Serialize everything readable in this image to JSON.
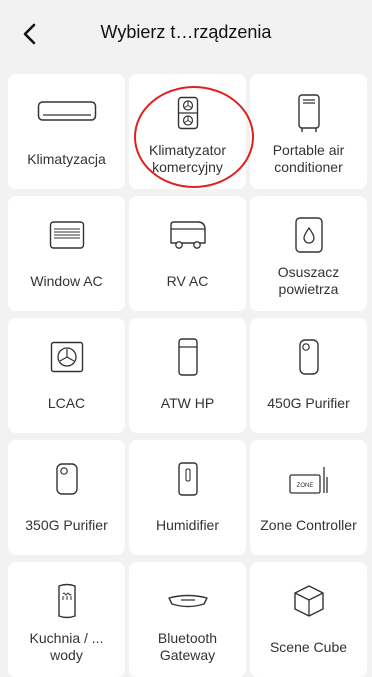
{
  "header": {
    "title": "Wybierz t…rządzenia",
    "back_icon": "chevron-left-icon"
  },
  "devices": [
    {
      "id": "klimatyzacja",
      "label": "Klimatyzacja",
      "icon": "wall-ac-icon"
    },
    {
      "id": "klimatyzator-komercyjny",
      "label": "Klimatyzator komercyjny",
      "icon": "commercial-ac-icon",
      "highlighted": true
    },
    {
      "id": "portable-air-conditioner",
      "label": "Portable air conditioner",
      "icon": "portable-ac-icon"
    },
    {
      "id": "window-ac",
      "label": "Window AC",
      "icon": "window-ac-icon"
    },
    {
      "id": "rv-ac",
      "label": "RV AC",
      "icon": "rv-icon"
    },
    {
      "id": "osuszacz-powietrza",
      "label": "Osuszacz powietrza",
      "icon": "dehumidifier-icon"
    },
    {
      "id": "lcac",
      "label": "LCAC",
      "icon": "fan-unit-icon"
    },
    {
      "id": "atw-hp",
      "label": "ATW HP",
      "icon": "heat-pump-icon"
    },
    {
      "id": "450g-purifier",
      "label": "450G Purifier",
      "icon": "purifier-icon"
    },
    {
      "id": "350g-purifier",
      "label": "350G Purifier",
      "icon": "purifier-small-icon"
    },
    {
      "id": "humidifier",
      "label": "Humidifier",
      "icon": "humidifier-icon"
    },
    {
      "id": "zone-controller",
      "label": "Zone Controller",
      "icon": "zone-controller-icon",
      "icon_text": "ZONE"
    },
    {
      "id": "kuchnia-wody",
      "label": "Kuchnia / ... wody",
      "icon": "water-heater-icon"
    },
    {
      "id": "bluetooth-gateway",
      "label": "Bluetooth Gateway",
      "icon": "gateway-icon"
    },
    {
      "id": "scene-cube",
      "label": "Scene Cube",
      "icon": "cube-icon"
    }
  ],
  "colors": {
    "highlight": "#e02020",
    "background": "#f2f2f2",
    "card": "#ffffff"
  }
}
